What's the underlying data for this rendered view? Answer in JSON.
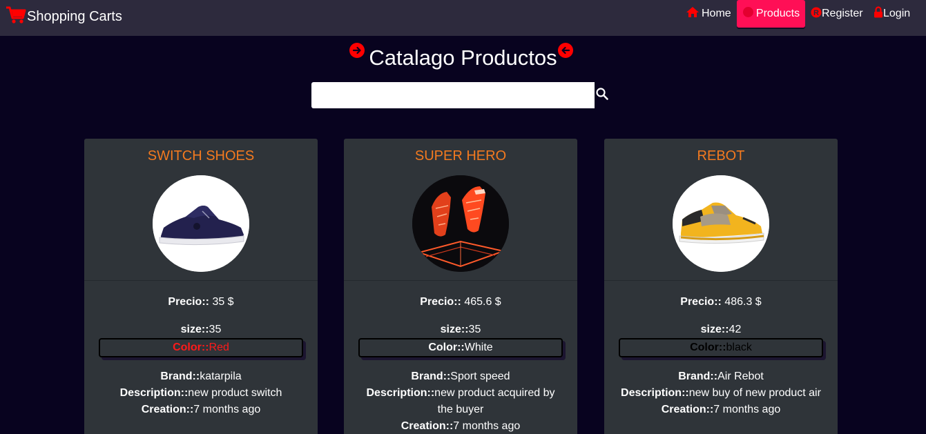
{
  "navbar": {
    "brand": "Shopping Carts",
    "links": [
      {
        "label": "Home",
        "icon": "home-icon"
      },
      {
        "label": "Products",
        "icon": "products-icon",
        "active": true
      },
      {
        "label": "Register",
        "icon": "register-icon"
      },
      {
        "label": "Login",
        "icon": "lock-icon"
      }
    ]
  },
  "page": {
    "title": "Catalago Productos",
    "search_value": ""
  },
  "labels": {
    "price": "Precio::",
    "size": "size::",
    "color": "Color::",
    "brand": "Brand::",
    "description": "Description::",
    "creation": "Creation::"
  },
  "products": [
    {
      "name": "SWITCH SHOES",
      "price": "35 $",
      "size": "35",
      "color": "Red",
      "color_text": "#ff1a1a",
      "brand": "katarpila",
      "description": "new product switch",
      "creation": "7 months ago"
    },
    {
      "name": "SUPER HERO",
      "price": "465.6 $",
      "size": "35",
      "color": "White",
      "color_text": "#ffffff",
      "brand": "Sport speed",
      "description": "new product acquired by the buyer",
      "creation": "7 months ago"
    },
    {
      "name": "REBOT",
      "price": "486.3 $",
      "size": "42",
      "color": "black",
      "color_text": "#000000",
      "brand": "Air Rebot",
      "description": "new buy of new product air",
      "creation": "7 months ago"
    }
  ],
  "colors": {
    "accent": "#ff0f56",
    "product_name": "#f47a1f",
    "icon_red": "#ff0000"
  }
}
